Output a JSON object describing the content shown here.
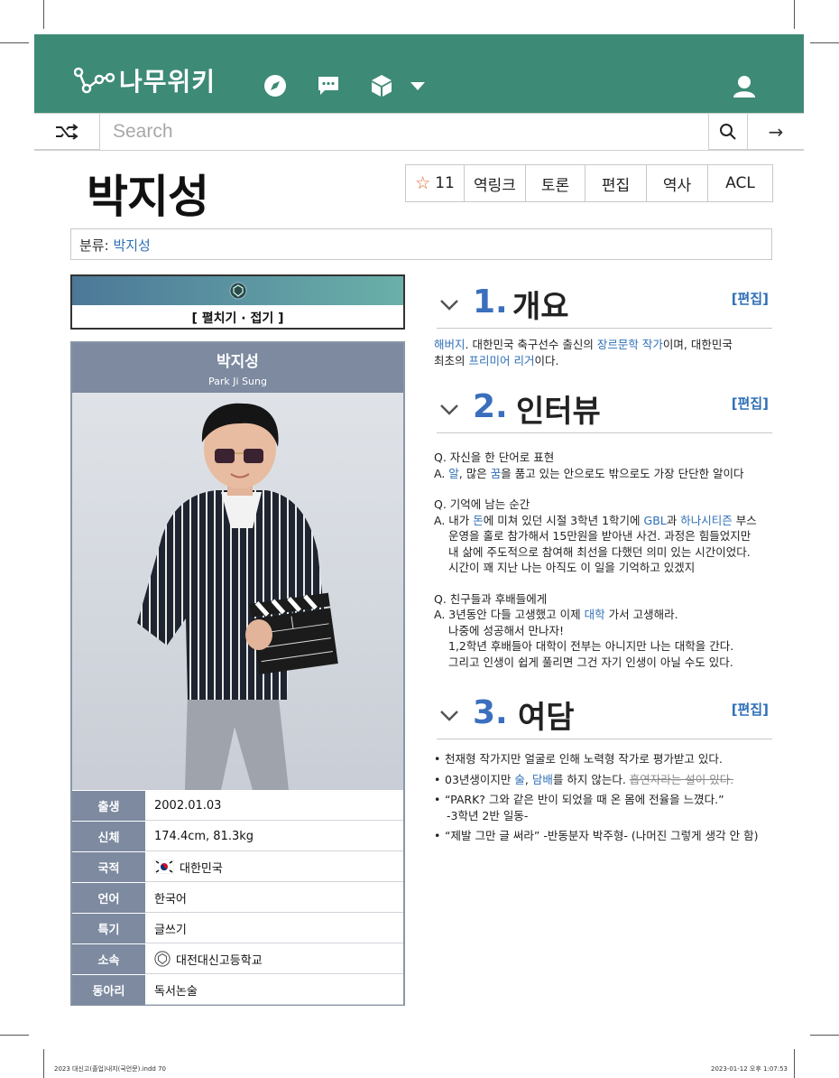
{
  "header": {
    "logo_text": "나무위키",
    "search_placeholder": "Search",
    "go_symbol": "→"
  },
  "title": "박지성",
  "actions": {
    "star_symbol": "☆",
    "star_count": "11",
    "backlink": "역링크",
    "discuss": "토론",
    "edit": "편집",
    "history": "역사",
    "acl": "ACL"
  },
  "category": {
    "label": "분류:",
    "value": "박지성"
  },
  "fold_label": "[ 펼치기 · 접기 ]",
  "infobox": {
    "name": "박지성",
    "name_en": "Park Ji Sung",
    "rows": [
      {
        "key": "출생",
        "value": "2002.01.03"
      },
      {
        "key": "신체",
        "value": "174.4cm, 81.3kg"
      },
      {
        "key": "국적",
        "value": "대한민국"
      },
      {
        "key": "언어",
        "value": "한국어"
      },
      {
        "key": "특기",
        "value": "글쓰기"
      },
      {
        "key": "소속",
        "value": "대전대신고등학교"
      },
      {
        "key": "동아리",
        "value": "독서논술"
      }
    ]
  },
  "sections": {
    "s1": {
      "num": "1.",
      "title": "개요",
      "edit": "[편집]"
    },
    "s2": {
      "num": "2.",
      "title": "인터뷰",
      "edit": "[편집]"
    },
    "s3": {
      "num": "3.",
      "title": "여담",
      "edit": "[편집]"
    }
  },
  "overview": {
    "a": "해버지",
    "b": ". 대한민국 축구선수 출신의 ",
    "c": "장르문학 작가",
    "d": "이며, 대한민국",
    "e": "최초의 ",
    "f": "프리미어 리거",
    "g": "이다."
  },
  "interview": {
    "q1": "Q. 자신을 한 단어로 표현",
    "a1_pre": "A. ",
    "a1_l1": "알",
    "a1_m": ", 많은 ",
    "a1_l2": "꿈",
    "a1_post": "을 품고 있는 안으로도 밖으로도 가장 단단한 알이다",
    "q2": "Q. 기억에 남는 순간",
    "a2_pre": "A.  내가 ",
    "a2_l1": "돈",
    "a2_m1": "에 미쳐 있던 시절 3학년 1학기에 ",
    "a2_l2": "GBL",
    "a2_m2": "과 ",
    "a2_l3": "하나시티즌",
    "a2_m3": " 부스",
    "a2_line2": "운영을 홀로 참가해서 15만원을 받아낸 사건. 과정은 힘들었지만",
    "a2_line3": "내 삶에 주도적으로 참여해 최선을 다했던 의미 있는 시간이었다.",
    "a2_line4": "시간이 꽤 지난 나는 아직도 이 일을 기억하고 있겠지",
    "q3": "Q. 친구들과 후배들에게",
    "a3_pre": "A. 3년동안 다들 고생했고 이제 ",
    "a3_l1": "대학",
    "a3_post": " 가서 고생해라.",
    "a3_line2": "나중에 성공해서 만나자!",
    "a3_line3": "1,2학년 후배들아 대학이 전부는 아니지만 나는 대학을 간다.",
    "a3_line4": "그리고 인생이 쉽게 풀리면 그건 자기 인생이 아닐 수도 있다."
  },
  "trivia": {
    "b1": "천재형 작가지만 얼굴로 인해 노력형 작가로 평가받고 있다.",
    "b2_pre": "03년생이지만 ",
    "b2_l1": "술",
    "b2_m": ", ",
    "b2_l2": "담배",
    "b2_post": "를 하지 않는다. ",
    "b2_strike": "흡연자라는 설이 있다.",
    "b3_l1": "“PARK? 그와 같은 반이 되었을 때 온 몸에 전율을 느꼈다.”",
    "b3_l2": "-3학년 2반 일동-",
    "b4": "“제발 그만 글 써라” -반동분자 박주형- (나머진 그렇게 생각 안 함)"
  },
  "footer": {
    "left": "2023 대신고(졸업)내지(국언문).indd   70",
    "right": "2023-01-12   오후 1:07:53"
  },
  "colors": {
    "header_bg": "#3d8a76",
    "link": "#2f6fb6",
    "section_num": "#3a6fbd",
    "infobox_key": "#7d8aa0",
    "star": "#e0662e"
  }
}
